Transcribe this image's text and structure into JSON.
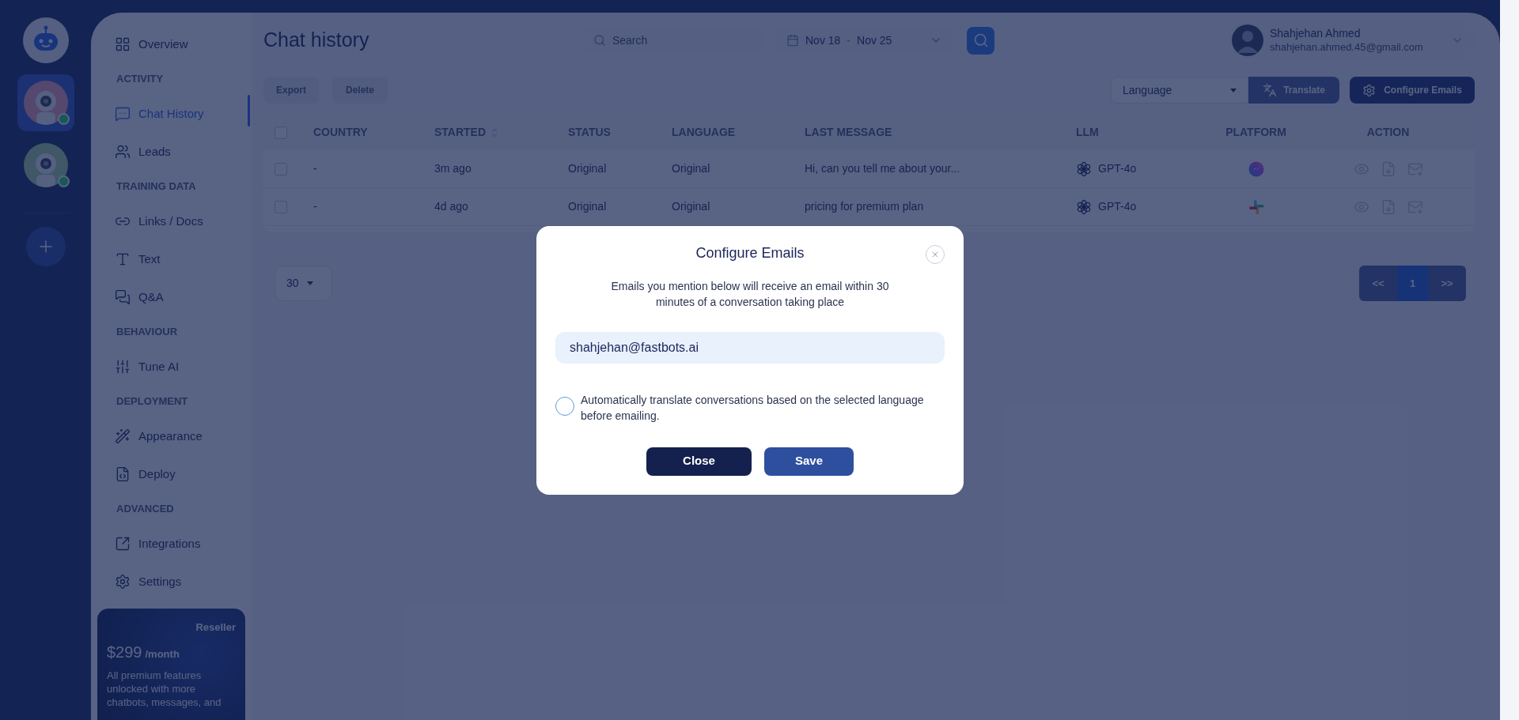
{
  "bots": [
    {
      "kind": "logo",
      "selected": false
    },
    {
      "kind": "avatar",
      "selected": true,
      "online": true
    },
    {
      "kind": "avatar",
      "selected": false,
      "online": true
    }
  ],
  "sidebar": {
    "items": [
      {
        "kind": "link",
        "label": "Overview",
        "selected": false
      },
      {
        "kind": "header",
        "label": "ACTIVITY"
      },
      {
        "kind": "link",
        "label": "Chat History",
        "selected": true
      },
      {
        "kind": "link",
        "label": "Leads",
        "selected": false
      },
      {
        "kind": "header",
        "label": "TRAINING DATA"
      },
      {
        "kind": "link",
        "label": "Links / Docs",
        "selected": false
      },
      {
        "kind": "link",
        "label": "Text",
        "selected": false
      },
      {
        "kind": "link",
        "label": "Q&A",
        "selected": false
      },
      {
        "kind": "header",
        "label": "BEHAVIOUR"
      },
      {
        "kind": "link",
        "label": "Tune AI",
        "selected": false
      },
      {
        "kind": "header",
        "label": "DEPLOYMENT"
      },
      {
        "kind": "link",
        "label": "Appearance",
        "selected": false
      },
      {
        "kind": "link",
        "label": "Deploy",
        "selected": false
      },
      {
        "kind": "header",
        "label": "ADVANCED"
      },
      {
        "kind": "link",
        "label": "Integrations",
        "selected": false
      },
      {
        "kind": "link",
        "label": "Settings",
        "selected": false
      }
    ]
  },
  "plan_card": {
    "badge": "Reseller",
    "price": "$299",
    "period": "/month",
    "description": "All premium features unlocked with more chatbots, messages, and"
  },
  "page_title": "Chat history",
  "search": {
    "placeholder": "Search"
  },
  "date_range": {
    "start": "Nov 18",
    "separator": "-",
    "end": "Nov 25"
  },
  "user": {
    "name": "Shahjehan Ahmed",
    "email": "shahjehan.ahmed.45@gmail.com"
  },
  "toolbar": {
    "export": {
      "label": "Export",
      "disabled": true
    },
    "delete": {
      "label": "Delete",
      "disabled": true
    },
    "language_select": "Language",
    "translate": {
      "label": "Translate",
      "disabled": true
    },
    "configure": "Configure Emails"
  },
  "table": {
    "select_all_checked": false,
    "columns": [
      {
        "label": "COUNTRY",
        "sortable": false
      },
      {
        "label": "STARTED",
        "sortable": true
      },
      {
        "label": "STATUS",
        "sortable": false
      },
      {
        "label": "LANGUAGE",
        "sortable": false
      },
      {
        "label": "LAST MESSAGE",
        "sortable": false
      },
      {
        "label": "LLM",
        "sortable": false
      },
      {
        "label": "PLATFORM",
        "sortable": false
      },
      {
        "label": "ACTION",
        "sortable": false
      }
    ],
    "rows": [
      {
        "checked": false,
        "country": "-",
        "started": "3m ago",
        "status": "Original",
        "language": "Original",
        "last_message": "Hi, can you tell me about your...",
        "llm": "GPT-4o"
      },
      {
        "checked": false,
        "country": "-",
        "started": "4d ago",
        "status": "Original",
        "language": "Original",
        "last_message": "pricing for premium plan",
        "llm": "GPT-4o"
      }
    ]
  },
  "page_size": "30",
  "pagination": [
    {
      "label": "<<",
      "selected": false
    },
    {
      "label": "1",
      "selected": true
    },
    {
      "label": ">>",
      "selected": false
    }
  ],
  "modal": {
    "title": "Configure Emails",
    "description": "Emails you mention below will receive an email within 30 minutes of a conversation taking place",
    "email": "shahjehan@fastbots.ai",
    "translate_option": {
      "label": "Automatically translate conversations based on the selected language before emailing.",
      "checked": false
    },
    "buttons": [
      {
        "kind": "close",
        "label": "Close"
      },
      {
        "kind": "save",
        "label": "Save"
      }
    ]
  }
}
